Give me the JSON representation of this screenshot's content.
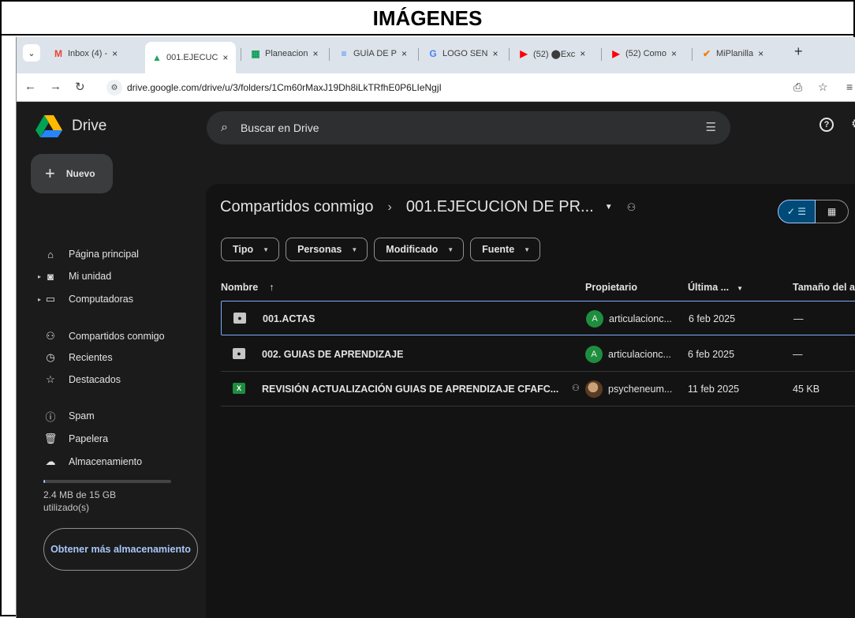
{
  "doc": {
    "title": "IMÁGENES"
  },
  "browser": {
    "tabs": [
      {
        "label": "Inbox (4) -",
        "favicon": "gmail-icon",
        "color": "#ea4335",
        "glyph": "M"
      },
      {
        "label": "001.EJECUC",
        "favicon": "drive-icon",
        "color": "#1fa463",
        "glyph": "▲"
      },
      {
        "label": "Planeacion",
        "favicon": "sheets-icon",
        "color": "#0f9d58",
        "glyph": "▦"
      },
      {
        "label": "GUÍA DE P",
        "favicon": "docs-icon",
        "color": "#4285f4",
        "glyph": "≡"
      },
      {
        "label": "LOGO SEN",
        "favicon": "google-icon",
        "color": "#4285f4",
        "glyph": "G"
      },
      {
        "label": "(52) ⬤Exc",
        "favicon": "youtube-icon",
        "color": "#ff0000",
        "glyph": "▶"
      },
      {
        "label": "(52) Como",
        "favicon": "youtube-icon",
        "color": "#ff0000",
        "glyph": "▶"
      },
      {
        "label": "MiPlanilla",
        "favicon": "check-icon",
        "color": "#f57c00",
        "glyph": "✔"
      }
    ],
    "tab_close": "×",
    "new_tab": "+",
    "url": "drive.google.com/drive/u/3/folders/1Cm60rMaxJ19Dh8iLkTRfhE0P6LIeNgjI"
  },
  "drive": {
    "logo_title": "Drive",
    "search_placeholder": "Buscar en Drive",
    "new_button": "Nuevo",
    "nav": [
      {
        "label": "Página principal",
        "icon": "home-icon",
        "glyph": "⌂"
      },
      {
        "label": "Mi unidad",
        "icon": "my-drive-icon",
        "glyph": "◙"
      },
      {
        "label": "Computadoras",
        "icon": "computer-icon",
        "glyph": "▭"
      },
      {
        "label": "Compartidos conmigo",
        "icon": "shared-icon",
        "glyph": "⚇"
      },
      {
        "label": "Recientes",
        "icon": "clock-icon",
        "glyph": "◷"
      },
      {
        "label": "Destacados",
        "icon": "star-icon",
        "glyph": "☆"
      },
      {
        "label": "Spam",
        "icon": "spam-icon",
        "glyph": "ⓘ"
      },
      {
        "label": "Papelera",
        "icon": "trash-icon",
        "glyph": "🗑"
      },
      {
        "label": "Almacenamiento",
        "icon": "cloud-icon",
        "glyph": "☁"
      }
    ],
    "storage_text": "2.4 MB de 15 GB utilizado(s)",
    "storage_fraction": 0.0002,
    "get_more_button": "Obtener más almacenamiento",
    "breadcrumb": {
      "parent": "Compartidos conmigo",
      "current": "001.EJECUCION DE PR..."
    },
    "filters": [
      "Tipo",
      "Personas",
      "Modificado",
      "Fuente"
    ],
    "columns": {
      "name": "Nombre",
      "owner": "Propietario",
      "modified": "Última ...",
      "size": "Tamaño del a"
    },
    "files": [
      {
        "name": "001.ACTAS",
        "type": "shared-folder",
        "owner": "articulacionc...",
        "owner_initial": "A",
        "date": "6 feb 2025",
        "size": "—",
        "shared": false,
        "selected": true
      },
      {
        "name": "002. GUIAS DE APRENDIZAJE",
        "type": "shared-folder",
        "owner": "articulacionc...",
        "owner_initial": "A",
        "date": "6 feb 2025",
        "size": "—",
        "shared": false,
        "selected": false
      },
      {
        "name": "REVISIÓN ACTUALIZACIÓN GUIAS DE APRENDIZAJE CFAFC...",
        "type": "spreadsheet",
        "owner": "psycheneum...",
        "owner_initial": "",
        "date": "11 feb 2025",
        "size": "45 KB",
        "shared": true,
        "selected": false
      }
    ]
  }
}
